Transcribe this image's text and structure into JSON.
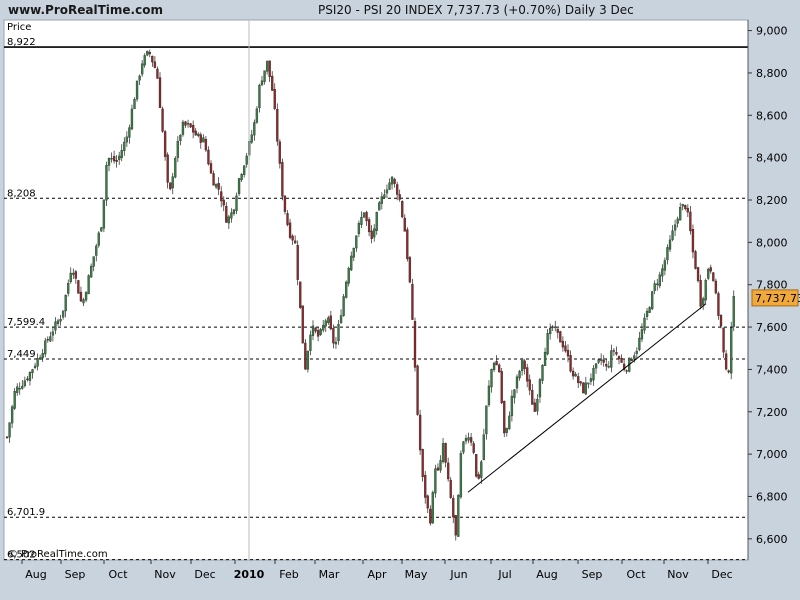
{
  "header": {
    "site": "www.ProRealTime.com",
    "instrument": "PSI20 - PSI 20 INDEX  7,737.73 (+0.70%)  Daily  3 Dec"
  },
  "panel": {
    "price_title": "Price",
    "watermark": "© ProRealTime.com",
    "last_price_label": "7,737.73"
  },
  "colors": {
    "background": "#c9d3dd",
    "plot": "#ffffff",
    "up_candle": "#3a7a45",
    "down_candle": "#8a2a2a",
    "last_price_tag": "#f2a93b"
  },
  "chart_data": {
    "type": "candlestick",
    "title": "PSI20 - PSI 20 INDEX",
    "ylim": [
      6500,
      9050
    ],
    "y_ticks": [
      6600,
      6800,
      7000,
      7200,
      7400,
      7600,
      7800,
      8000,
      8200,
      8400,
      8600,
      8800,
      9000
    ],
    "y_tick_labels": [
      "6,600",
      "6,800",
      "7,000",
      "7,200",
      "7,400",
      "7,600",
      "7,800",
      "8,000",
      "8,200",
      "8,400",
      "8,600",
      "8,800",
      "9,000"
    ],
    "x_ticks": [
      "Aug",
      "Sep",
      "Oct",
      "Nov",
      "Dec",
      "2010",
      "Feb",
      "Mar",
      "Apr",
      "May",
      "Jun",
      "Jul",
      "Aug",
      "Sep",
      "Oct",
      "Nov",
      "Dec"
    ],
    "horizontal_levels": [
      {
        "value": 8922,
        "label": "8,922",
        "style": "solid"
      },
      {
        "value": 8208,
        "label": "8,208",
        "style": "dashed"
      },
      {
        "value": 7599.4,
        "label": "7,599.4",
        "style": "dashed"
      },
      {
        "value": 7449,
        "label": "7,449",
        "style": "dashed"
      },
      {
        "value": 6701.9,
        "label": "6,701.9",
        "style": "dashed"
      },
      {
        "value": 6502,
        "label": "6,502",
        "style": "dashed"
      }
    ],
    "trendline": {
      "from": {
        "x": "Jun",
        "value": 6820
      },
      "to": {
        "x": "Nov",
        "value": 7710
      }
    },
    "last_price": 7737.73,
    "change_pct": 0.7,
    "path": [
      [
        0,
        7080
      ],
      [
        8,
        7300
      ],
      [
        20,
        7360
      ],
      [
        32,
        7460
      ],
      [
        45,
        7580
      ],
      [
        55,
        7660
      ],
      [
        65,
        7900
      ],
      [
        75,
        7700
      ],
      [
        85,
        7900
      ],
      [
        95,
        8100
      ],
      [
        100,
        8400
      ],
      [
        110,
        8380
      ],
      [
        120,
        8500
      ],
      [
        128,
        8700
      ],
      [
        135,
        8850
      ],
      [
        142,
        8900
      ],
      [
        150,
        8800
      ],
      [
        156,
        8500
      ],
      [
        162,
        8200
      ],
      [
        168,
        8400
      ],
      [
        175,
        8550
      ],
      [
        182,
        8550
      ],
      [
        190,
        8500
      ],
      [
        197,
        8480
      ],
      [
        205,
        8300
      ],
      [
        212,
        8250
      ],
      [
        220,
        8100
      ],
      [
        226,
        8150
      ],
      [
        232,
        8300
      ],
      [
        240,
        8420
      ],
      [
        247,
        8550
      ],
      [
        253,
        8750
      ],
      [
        260,
        8850
      ],
      [
        266,
        8700
      ],
      [
        270,
        8500
      ],
      [
        276,
        8200
      ],
      [
        282,
        8050
      ],
      [
        288,
        8000
      ],
      [
        293,
        7700
      ],
      [
        298,
        7400
      ],
      [
        304,
        7600
      ],
      [
        312,
        7550
      ],
      [
        320,
        7650
      ],
      [
        328,
        7500
      ],
      [
        335,
        7700
      ],
      [
        342,
        7900
      ],
      [
        350,
        8050
      ],
      [
        357,
        8150
      ],
      [
        364,
        8000
      ],
      [
        371,
        8150
      ],
      [
        378,
        8250
      ],
      [
        385,
        8300
      ],
      [
        392,
        8220
      ],
      [
        398,
        8050
      ],
      [
        403,
        7800
      ],
      [
        407,
        7500
      ],
      [
        411,
        7150
      ],
      [
        415,
        6900
      ],
      [
        420,
        6750
      ],
      [
        424,
        6680
      ],
      [
        428,
        6950
      ],
      [
        432,
        6900
      ],
      [
        436,
        7050
      ],
      [
        440,
        6900
      ],
      [
        445,
        6750
      ],
      [
        449,
        6600
      ],
      [
        454,
        7000
      ],
      [
        460,
        7100
      ],
      [
        466,
        7050
      ],
      [
        470,
        6850
      ],
      [
        474,
        6950
      ],
      [
        480,
        7250
      ],
      [
        486,
        7450
      ],
      [
        492,
        7400
      ],
      [
        498,
        7050
      ],
      [
        504,
        7250
      ],
      [
        510,
        7350
      ],
      [
        516,
        7450
      ],
      [
        522,
        7300
      ],
      [
        528,
        7200
      ],
      [
        534,
        7400
      ],
      [
        540,
        7550
      ],
      [
        546,
        7600
      ],
      [
        552,
        7550
      ],
      [
        558,
        7500
      ],
      [
        564,
        7400
      ],
      [
        570,
        7350
      ],
      [
        576,
        7300
      ],
      [
        582,
        7350
      ],
      [
        588,
        7400
      ],
      [
        594,
        7450
      ],
      [
        600,
        7400
      ],
      [
        606,
        7500
      ],
      [
        612,
        7450
      ],
      [
        618,
        7400
      ],
      [
        624,
        7450
      ],
      [
        630,
        7500
      ],
      [
        636,
        7600
      ],
      [
        642,
        7700
      ],
      [
        648,
        7800
      ],
      [
        654,
        7850
      ],
      [
        660,
        7950
      ],
      [
        666,
        8050
      ],
      [
        672,
        8150
      ],
      [
        678,
        8180
      ],
      [
        682,
        8100
      ],
      [
        686,
        7950
      ],
      [
        690,
        7850
      ],
      [
        694,
        7700
      ],
      [
        698,
        7800
      ],
      [
        702,
        7900
      ],
      [
        706,
        7850
      ],
      [
        710,
        7700
      ],
      [
        714,
        7600
      ],
      [
        718,
        7400
      ],
      [
        721,
        7350
      ],
      [
        724,
        7600
      ],
      [
        727,
        7737.73
      ]
    ]
  }
}
